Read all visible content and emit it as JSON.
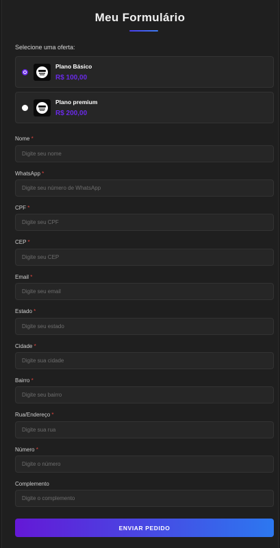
{
  "form": {
    "title": "Meu Formulário",
    "offer_prompt": "Selecione uma oferta:",
    "required_mark": "*"
  },
  "offers": [
    {
      "name": "Plano Básico",
      "price": "R$ 100,00",
      "selected": true
    },
    {
      "name": "Plano premium",
      "price": "R$ 200,00",
      "selected": false
    }
  ],
  "fields": [
    {
      "label": "Nome",
      "required": true,
      "placeholder": "Digite seu nome"
    },
    {
      "label": "WhatsApp",
      "required": true,
      "placeholder": "Digite seu número de WhatsApp"
    },
    {
      "label": "CPF",
      "required": true,
      "placeholder": "Digite seu CPF"
    },
    {
      "label": "CEP",
      "required": true,
      "placeholder": "Digite seu CEP"
    },
    {
      "label": "Email",
      "required": true,
      "placeholder": "Digite seu email"
    },
    {
      "label": "Estado",
      "required": true,
      "placeholder": "Digite seu estado"
    },
    {
      "label": "Cidade",
      "required": true,
      "placeholder": "Digite sua cidade"
    },
    {
      "label": "Bairro",
      "required": true,
      "placeholder": "Digite seu bairro"
    },
    {
      "label": "Rua/Endereço",
      "required": true,
      "placeholder": "Digite sua rua"
    },
    {
      "label": "Número",
      "required": true,
      "placeholder": "Digite o número"
    },
    {
      "label": "Complemento",
      "required": false,
      "placeholder": "Digite o complemento"
    }
  ],
  "submit_label": "ENVIAR PEDIDO",
  "colors": {
    "accent": "#6a2ae8",
    "required": "#e0453f",
    "button_gradient_start": "#6418d6",
    "button_gradient_end": "#2c78f0"
  },
  "icons": {
    "offer_logo": "product-logo-icon"
  }
}
